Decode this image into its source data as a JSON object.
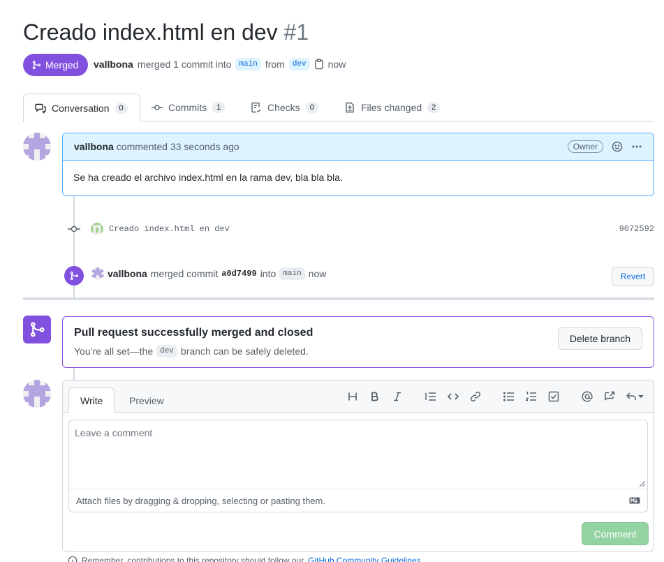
{
  "pr": {
    "title": "Creado index.html en dev",
    "number": "#1",
    "status": "Merged",
    "author": "vallbona",
    "meta_merged": "merged 1 commit into",
    "base_branch": "main",
    "meta_from": "from",
    "head_branch": "dev",
    "time": "now"
  },
  "tabs": [
    {
      "label": "Conversation",
      "count": "0",
      "icon": "comment-discussion-icon"
    },
    {
      "label": "Commits",
      "count": "1",
      "icon": "git-commit-icon"
    },
    {
      "label": "Checks",
      "count": "0",
      "icon": "checklist-icon"
    },
    {
      "label": "Files changed",
      "count": "2",
      "icon": "file-diff-icon"
    }
  ],
  "comment": {
    "author": "vallbona",
    "action": "commented 33 seconds ago",
    "badge": "Owner",
    "body": "Se ha creado el archivo index.html en la rama dev, bla bla bla."
  },
  "commit": {
    "message": "Creado index.html en dev",
    "sha": "9072592"
  },
  "merge_event": {
    "author": "vallbona",
    "text": "merged commit",
    "sha": "a0d7499",
    "into": "into",
    "branch": "main",
    "time": "now",
    "revert_label": "Revert"
  },
  "merged_box": {
    "title": "Pull request successfully merged and closed",
    "sub_before": "You’re all set—the",
    "branch": "dev",
    "sub_after": "branch can be safely deleted.",
    "delete_label": "Delete branch"
  },
  "editor": {
    "write_tab": "Write",
    "preview_tab": "Preview",
    "placeholder": "Leave a comment",
    "attach_text": "Attach files by dragging & dropping, selecting or pasting them.",
    "submit_label": "Comment"
  },
  "footnote": {
    "text": "Remember, contributions to this repository should follow our",
    "link": "GitHub Community Guidelines."
  },
  "colors": {
    "merged": "#8250df",
    "link": "#0969da",
    "comment_disabled": "#94d3a2"
  }
}
